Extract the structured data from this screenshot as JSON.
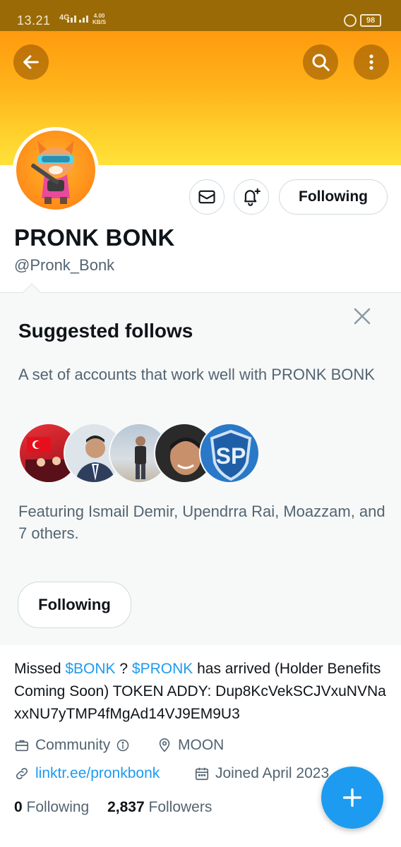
{
  "status_bar": {
    "time": "13.21",
    "network": "4G",
    "speed_value": "4.00",
    "speed_unit": "KB/S",
    "battery": "98"
  },
  "profile": {
    "name": "PRONK BONK",
    "handle": "@Pronk_Bonk",
    "following_button": "Following",
    "bio_parts": {
      "p1": "Missed ",
      "tag1": "$BONK",
      "p2": " ? ",
      "tag2": "$PRONK",
      "p3": " has arrived (Holder Benefits Coming Soon) TOKEN ADDY: Dup8KcVekSCJVxuNVNaxxNU7yTMP4fMgAd14VJ9EM9U3"
    },
    "category": "Community",
    "location": "MOON",
    "website": "linktr.ee/pronkbonk",
    "joined": "Joined April 2023",
    "following_count": "0",
    "following_label": "Following",
    "followers_count": "2,837",
    "followers_label": "Followers"
  },
  "suggested": {
    "title": "Suggested follows",
    "subtitle": "A set of accounts that work well with PRONK BONK",
    "featuring": "Featuring Ismail Demir, Upendrra Rai, Moazzam, and 7 others.",
    "button": "Following"
  },
  "colors": {
    "accent": "#1d9bf0",
    "banner_top": "#ff9a0e",
    "banner_bottom": "#ffe23a",
    "status_bar": "#9a6a06"
  },
  "icons": [
    "back-arrow-icon",
    "search-icon",
    "more-vertical-icon",
    "mail-icon",
    "bell-plus-icon",
    "close-icon",
    "briefcase-icon",
    "info-icon",
    "location-pin-icon",
    "link-icon",
    "calendar-icon",
    "plus-icon"
  ]
}
